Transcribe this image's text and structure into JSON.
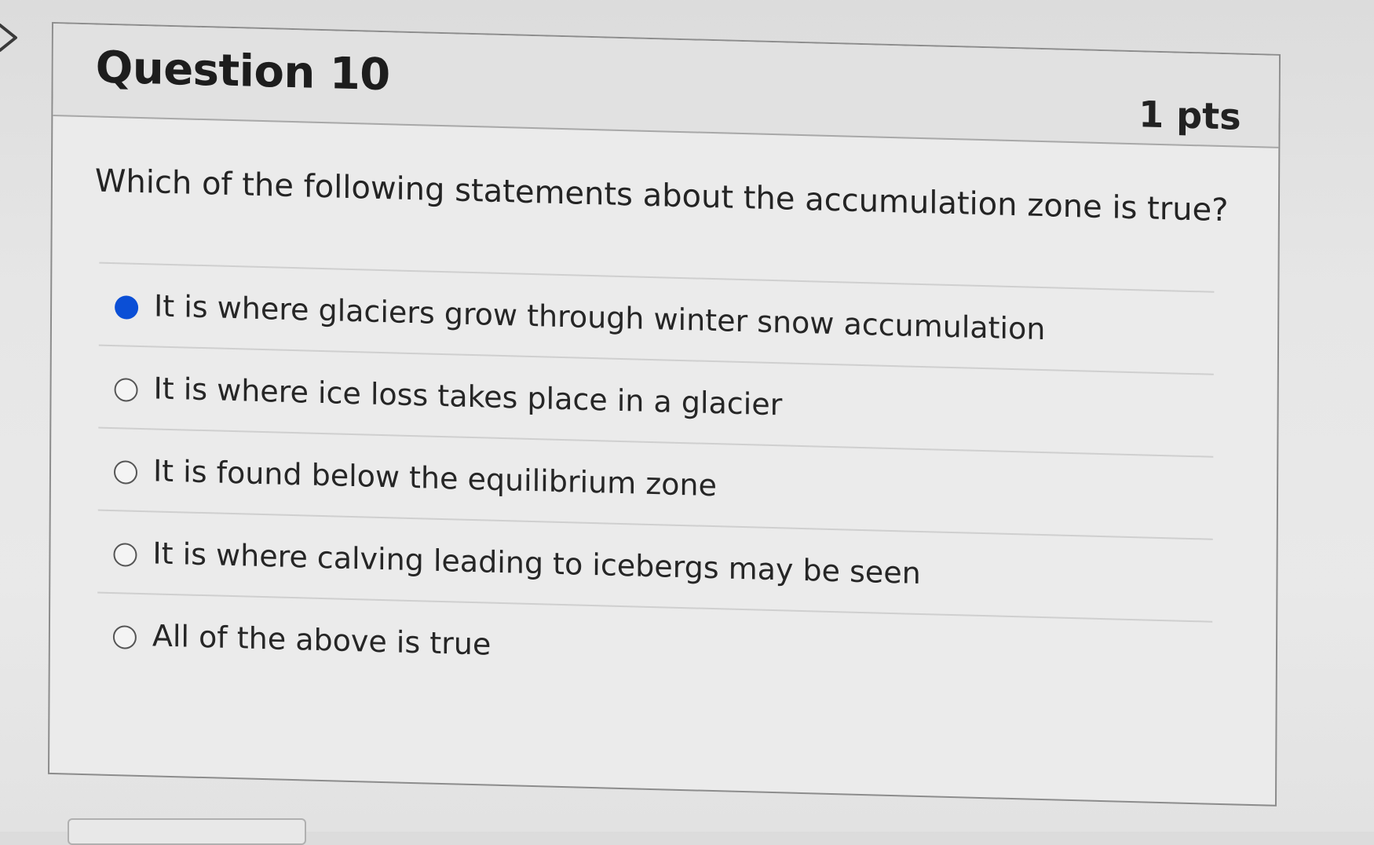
{
  "question": {
    "title": "Question 10",
    "points": "1 pts",
    "text": "Which of the following statements about the accumulation zone is true?"
  },
  "answers": [
    {
      "label": "It is where glaciers grow through winter snow accumulation",
      "selected": true
    },
    {
      "label": "It is where ice loss takes place in a glacier",
      "selected": false
    },
    {
      "label": "It is found below the equilibrium zone",
      "selected": false
    },
    {
      "label": "It is where calving leading to icebergs may be seen",
      "selected": false
    },
    {
      "label": "All of the above is true",
      "selected": false
    }
  ],
  "icons": {
    "collapse": "chevron-right-icon"
  },
  "colors": {
    "selected_radio": "#0b4fd6",
    "card_border": "#8c8c8c",
    "text": "#242424"
  }
}
